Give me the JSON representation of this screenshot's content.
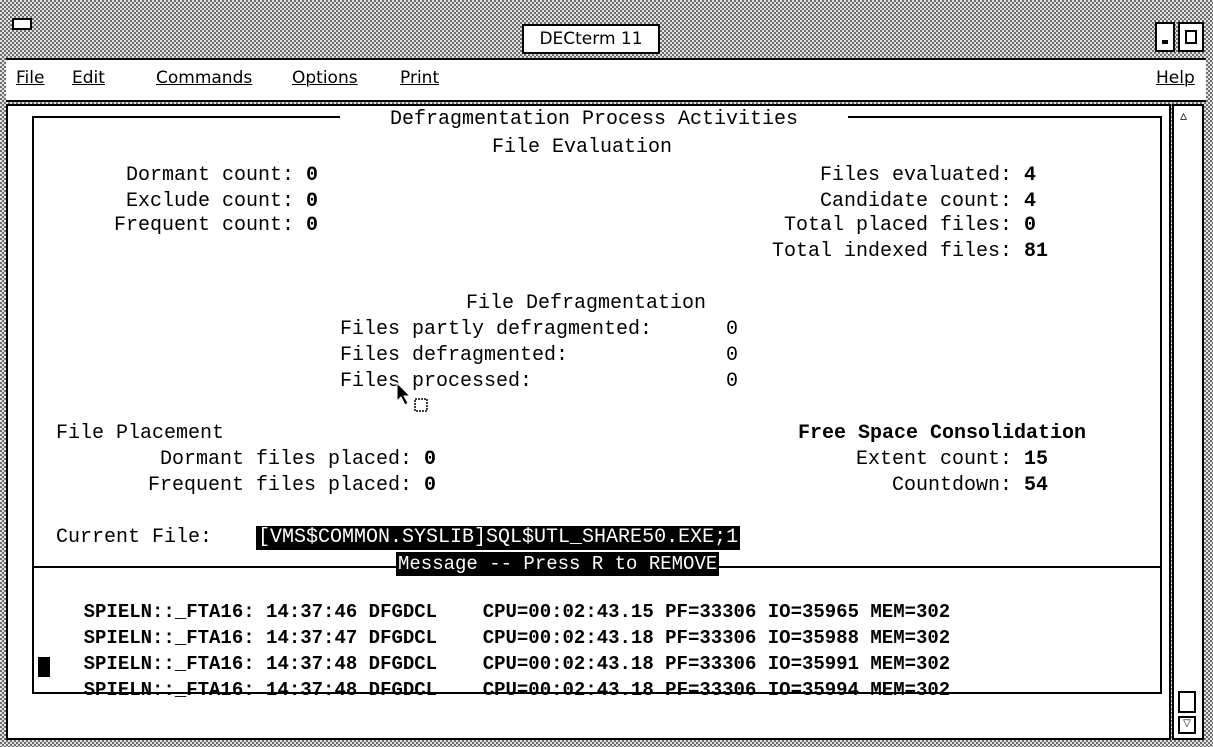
{
  "window": {
    "title": "DECterm 11"
  },
  "menubar": {
    "items": [
      "File",
      "Edit",
      "Commands",
      "Options",
      "Print"
    ],
    "help": "Help"
  },
  "panel": {
    "title": "Defragmentation Process Activities"
  },
  "file_evaluation": {
    "heading": "File Evaluation",
    "left": [
      {
        "label": "Dormant count:",
        "value": "0"
      },
      {
        "label": "Exclude count:",
        "value": "0"
      },
      {
        "label": "Frequent count:",
        "value": "0"
      }
    ],
    "right": [
      {
        "label": "Files evaluated:",
        "value": "4"
      },
      {
        "label": "Candidate count:",
        "value": "4"
      },
      {
        "label": "Total placed files:",
        "value": "0"
      },
      {
        "label": "Total indexed files:",
        "value": "81"
      }
    ]
  },
  "file_defragmentation": {
    "heading": "File Defragmentation",
    "rows": [
      {
        "label": "Files partly defragmented:",
        "value": "0"
      },
      {
        "label": "Files defragmented:",
        "value": "0"
      },
      {
        "label": "Files processed:",
        "value": "0"
      }
    ]
  },
  "file_placement": {
    "heading": "File Placement",
    "rows": [
      {
        "label": "Dormant files placed:",
        "value": "0"
      },
      {
        "label": "Frequent files placed:",
        "value": "0"
      }
    ]
  },
  "free_space": {
    "heading": "Free Space Consolidation",
    "rows": [
      {
        "label": "Extent count:",
        "value": "15"
      },
      {
        "label": "Countdown:",
        "value": "54"
      }
    ]
  },
  "current_file": {
    "label": "Current File:",
    "value": "[VMS$COMMON.SYSLIB]SQL$UTL_SHARE50.EXE;1"
  },
  "message_bar": {
    "text": "Message -- Press R to REMOVE"
  },
  "log_lines": [
    {
      "node": "SPIELN::_FTA16:",
      "time": "14:37:46",
      "proc": "DFGDCL",
      "cpu": "CPU=00:02:43.15",
      "pf": "PF=33306",
      "io": "IO=35965",
      "mem": "MEM=302"
    },
    {
      "node": "SPIELN::_FTA16:",
      "time": "14:37:47",
      "proc": "DFGDCL",
      "cpu": "CPU=00:02:43.18",
      "pf": "PF=33306",
      "io": "IO=35988",
      "mem": "MEM=302"
    },
    {
      "node": "SPIELN::_FTA16:",
      "time": "14:37:48",
      "proc": "DFGDCL",
      "cpu": "CPU=00:02:43.18",
      "pf": "PF=33306",
      "io": "IO=35991",
      "mem": "MEM=302"
    },
    {
      "node": "SPIELN::_FTA16:",
      "time": "14:37:48",
      "proc": "DFGDCL",
      "cpu": "CPU=00:02:43.18",
      "pf": "PF=33306",
      "io": "IO=35994",
      "mem": "MEM=302"
    }
  ]
}
